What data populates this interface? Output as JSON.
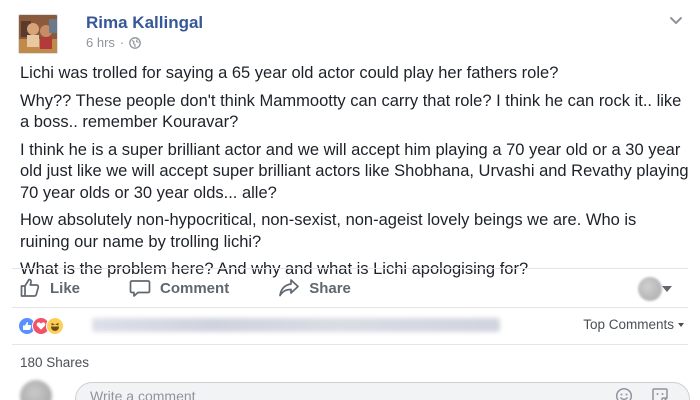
{
  "post": {
    "author": "Rima Kallingal",
    "time": "6 hrs",
    "separator": "·",
    "paragraphs": [
      "Lichi was trolled for saying a 65 year old actor could play her fathers role?",
      "Why?? These people don't think Mammootty can carry that role? I think he can rock it.. like a boss.. remember Kouravar?",
      "I think he is a super brilliant actor and we will accept him playing a 70 year old or a 30 year old just like we will accept super brilliant actors like Shobhana, Urvashi and Revathy playing 70 year olds or 30 year olds... alle?",
      "How absolutely non-hypocritical, non-sexist, non-ageist lovely beings we are. Who is ruining our name by trolling lichi?",
      "What is the problem here? And why and what is Lichi apologising for?"
    ]
  },
  "actions": {
    "like": "Like",
    "comment": "Comment",
    "share": "Share"
  },
  "reactions": {
    "icons": [
      "like-icon",
      "love-icon",
      "haha-icon"
    ],
    "sort_label": "Top Comments"
  },
  "shares": "180 Shares",
  "composer": {
    "placeholder": "Write a comment"
  },
  "colors": {
    "link_blue": "#365899",
    "secondary_text": "#90949c",
    "action_text": "#606770",
    "like_blue": "#5890ff",
    "love_red": "#f25268",
    "haha_yellow": "#fcd058"
  }
}
